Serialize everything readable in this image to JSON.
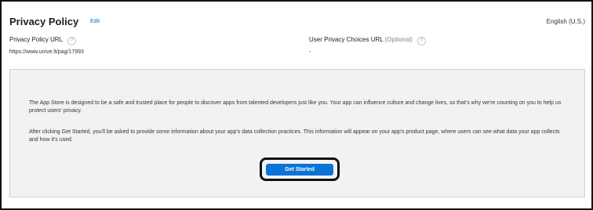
{
  "header": {
    "title": "Privacy Policy",
    "edit_label": "Edit",
    "language": "English (U.S.)"
  },
  "fields": {
    "privacy_policy_url": {
      "label": "Privacy Policy URL",
      "help": "?",
      "value": "https://www.unive.lt/pag/17993"
    },
    "user_privacy_choices_url": {
      "label": "User Privacy Choices URL",
      "optional": "(Optional)",
      "help": "?",
      "value": "-"
    }
  },
  "panel": {
    "paragraph_1": "The App Store is designed to be a safe and trusted place for people to discover apps from talented developers just like you. Your app can influence culture and change lives, so that's why we're counting on you to help us protect users' privacy.",
    "paragraph_2": "After clicking Get Started, you'll be asked to provide some information about your app's data collection practices. This information will appear on your app's product page, where users can see what data your app collects and how it's used.",
    "button_label": "Get Started"
  },
  "colors": {
    "accent": "#0a73d8",
    "link": "#0070c9",
    "panel_bg": "#f2f2f2"
  }
}
